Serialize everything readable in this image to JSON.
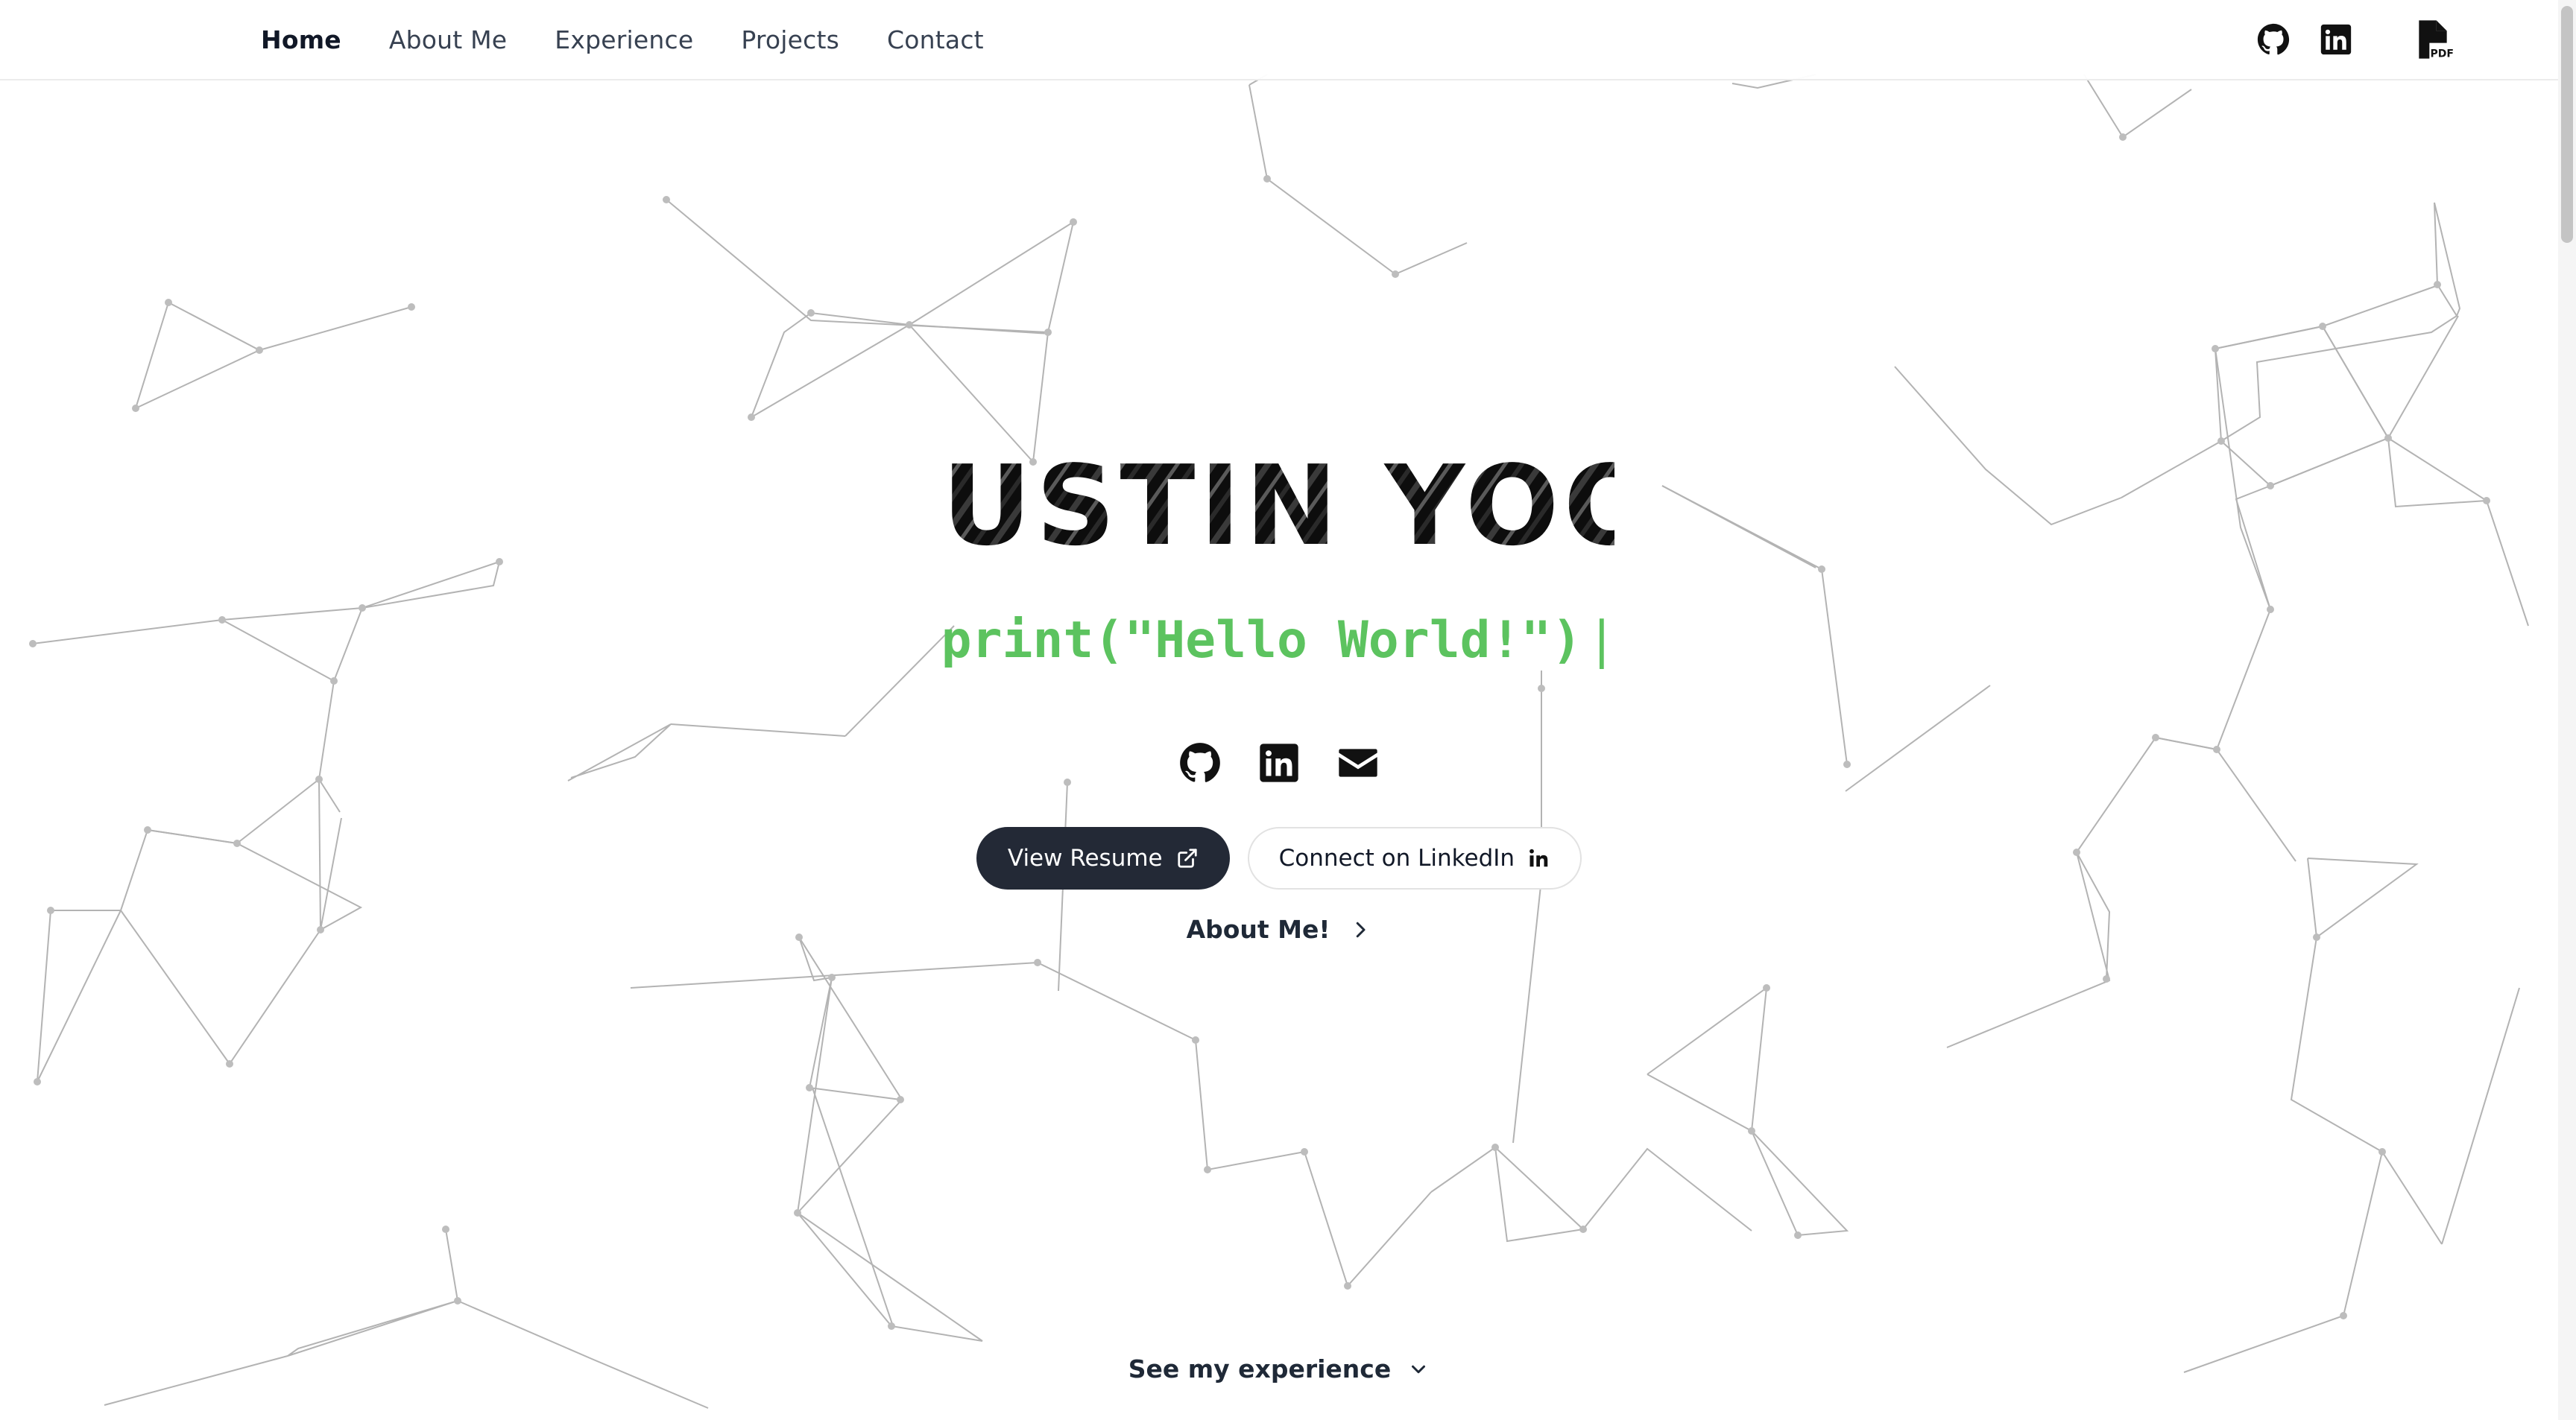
{
  "nav": {
    "links": [
      {
        "label": "Home",
        "active": true
      },
      {
        "label": "About Me",
        "active": false
      },
      {
        "label": "Experience",
        "active": false
      },
      {
        "label": "Projects",
        "active": false
      },
      {
        "label": "Contact",
        "active": false
      }
    ],
    "icons": [
      "github-icon",
      "linkedin-icon",
      "pdf-file-icon"
    ]
  },
  "hero": {
    "name": "JUSTIN YOO",
    "code_text": "print(\"Hello World!\")",
    "cursor": "|",
    "social_icons": [
      "github-icon",
      "linkedin-icon",
      "envelope-icon"
    ],
    "view_resume_label": "View Resume",
    "connect_linkedin_label": "Connect on LinkedIn",
    "about_label": "About Me!",
    "see_experience_label": "See my experience"
  },
  "colors": {
    "code_green": "#5cc35f",
    "dark_button": "#232936",
    "text": "#1f2937",
    "network_lines": "#9a9a9a"
  }
}
